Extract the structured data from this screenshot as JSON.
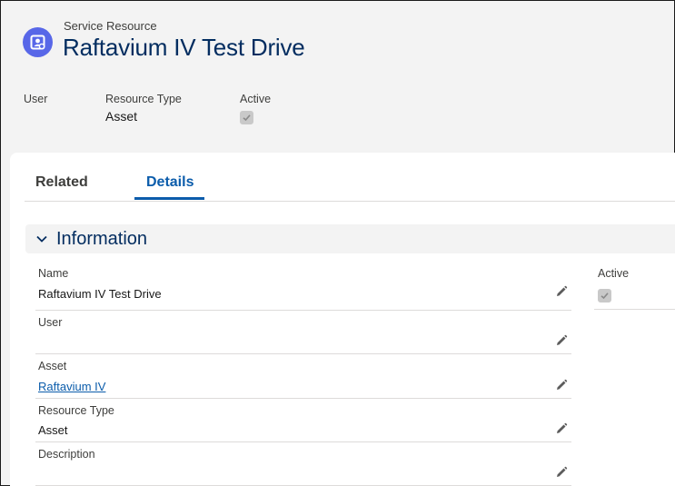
{
  "header": {
    "object_type": "Service Resource",
    "title": "Raftavium IV Test Drive",
    "highlights": [
      {
        "label": "User",
        "value": ""
      },
      {
        "label": "Resource Type",
        "value": "Asset"
      },
      {
        "label": "Active",
        "value": "",
        "checked": true
      }
    ]
  },
  "tabs": [
    {
      "label": "Related",
      "active": false
    },
    {
      "label": "Details",
      "active": true
    }
  ],
  "section": {
    "title": "Information",
    "expanded": true
  },
  "fields": [
    {
      "label": "Name",
      "value": "Raftavium IV Test Drive"
    },
    {
      "label": "User",
      "value": ""
    },
    {
      "label": "Asset",
      "value": "Raftavium IV",
      "link": true
    },
    {
      "label": "Resource Type",
      "value": "Asset"
    },
    {
      "label": "Description",
      "value": ""
    }
  ],
  "right_field": {
    "label": "Active",
    "checked": true
  },
  "colors": {
    "accent": "#0b5cab",
    "title": "#032d60",
    "icon_bg": "#5867e8"
  }
}
